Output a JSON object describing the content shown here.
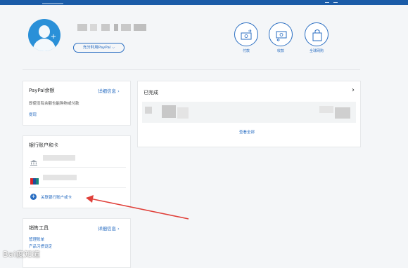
{
  "header": {
    "use_paypal_button": "充分利用PayPal",
    "quick_actions": [
      {
        "label": "付款",
        "icon": "send-money-icon"
      },
      {
        "label": "收款",
        "icon": "request-money-icon"
      },
      {
        "label": "全球网购",
        "icon": "shopping-bag-icon"
      }
    ]
  },
  "balance_card": {
    "title": "PayPal余额",
    "details_link": "详细信息 ",
    "description": "即使没有余额也能购物或付款",
    "withdraw_link": "提现"
  },
  "bank_card": {
    "title": "银行账户和卡",
    "link_bank_or_card": "关联银行账户或卡"
  },
  "sales_card": {
    "title": "销售工具",
    "details_link": "详细信息 ",
    "items": [
      "管理账单",
      "产品习惯设定"
    ]
  },
  "activity_card": {
    "title": "已完成",
    "view_all": "查看全部"
  },
  "watermark": {
    "text": "Bai度知道"
  },
  "colors": {
    "brand_blue": "#1b5ca8",
    "link_blue": "#2a6ec2",
    "annotation_red": "#e0403a"
  }
}
